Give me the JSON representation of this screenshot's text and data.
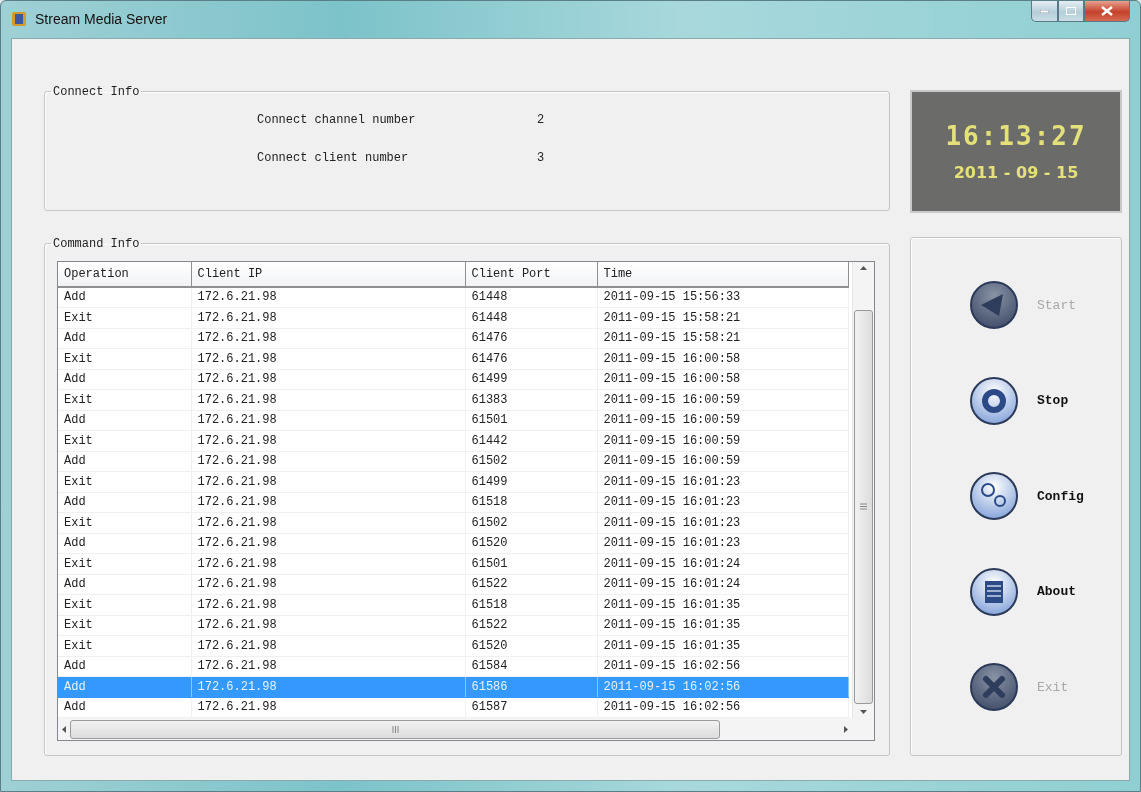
{
  "window": {
    "title": "Stream Media Server"
  },
  "connect_info": {
    "title": "Connect Info",
    "items": [
      {
        "label": "Connect channel number",
        "value": "2"
      },
      {
        "label": "Connect client number",
        "value": "3"
      }
    ]
  },
  "clock": {
    "time": "16:13:27",
    "date": "2011 - 09 - 15"
  },
  "command_info": {
    "title": "Command Info",
    "columns": [
      "Operation",
      "Client IP",
      "Client Port",
      "Time"
    ],
    "rows": [
      {
        "cells": [
          "Add",
          "172.6.21.98",
          "61448",
          "2011-09-15 15:56:33"
        ],
        "selected": false
      },
      {
        "cells": [
          "Exit",
          "172.6.21.98",
          "61448",
          "2011-09-15 15:58:21"
        ],
        "selected": false
      },
      {
        "cells": [
          "Add",
          "172.6.21.98",
          "61476",
          "2011-09-15 15:58:21"
        ],
        "selected": false
      },
      {
        "cells": [
          "Exit",
          "172.6.21.98",
          "61476",
          "2011-09-15 16:00:58"
        ],
        "selected": false
      },
      {
        "cells": [
          "Add",
          "172.6.21.98",
          "61499",
          "2011-09-15 16:00:58"
        ],
        "selected": false
      },
      {
        "cells": [
          "Exit",
          "172.6.21.98",
          "61383",
          "2011-09-15 16:00:59"
        ],
        "selected": false
      },
      {
        "cells": [
          "Add",
          "172.6.21.98",
          "61501",
          "2011-09-15 16:00:59"
        ],
        "selected": false
      },
      {
        "cells": [
          "Exit",
          "172.6.21.98",
          "61442",
          "2011-09-15 16:00:59"
        ],
        "selected": false
      },
      {
        "cells": [
          "Add",
          "172.6.21.98",
          "61502",
          "2011-09-15 16:00:59"
        ],
        "selected": false
      },
      {
        "cells": [
          "Exit",
          "172.6.21.98",
          "61499",
          "2011-09-15 16:01:23"
        ],
        "selected": false
      },
      {
        "cells": [
          "Add",
          "172.6.21.98",
          "61518",
          "2011-09-15 16:01:23"
        ],
        "selected": false
      },
      {
        "cells": [
          "Exit",
          "172.6.21.98",
          "61502",
          "2011-09-15 16:01:23"
        ],
        "selected": false
      },
      {
        "cells": [
          "Add",
          "172.6.21.98",
          "61520",
          "2011-09-15 16:01:23"
        ],
        "selected": false
      },
      {
        "cells": [
          "Exit",
          "172.6.21.98",
          "61501",
          "2011-09-15 16:01:24"
        ],
        "selected": false
      },
      {
        "cells": [
          "Add",
          "172.6.21.98",
          "61522",
          "2011-09-15 16:01:24"
        ],
        "selected": false
      },
      {
        "cells": [
          "Exit",
          "172.6.21.98",
          "61518",
          "2011-09-15 16:01:35"
        ],
        "selected": false
      },
      {
        "cells": [
          "Exit",
          "172.6.21.98",
          "61522",
          "2011-09-15 16:01:35"
        ],
        "selected": false
      },
      {
        "cells": [
          "Exit",
          "172.6.21.98",
          "61520",
          "2011-09-15 16:01:35"
        ],
        "selected": false
      },
      {
        "cells": [
          "Add",
          "172.6.21.98",
          "61584",
          "2011-09-15 16:02:56"
        ],
        "selected": false
      },
      {
        "cells": [
          "Add",
          "172.6.21.98",
          "61586",
          "2011-09-15 16:02:56"
        ],
        "selected": true
      },
      {
        "cells": [
          "Add",
          "172.6.21.98",
          "61587",
          "2011-09-15 16:02:56"
        ],
        "selected": false
      }
    ]
  },
  "buttons": [
    {
      "kind": "start",
      "label": "Start",
      "disabled": true
    },
    {
      "kind": "stop",
      "label": "Stop",
      "disabled": false
    },
    {
      "kind": "config",
      "label": "Config",
      "disabled": false
    },
    {
      "kind": "about",
      "label": "About",
      "disabled": false
    },
    {
      "kind": "exit",
      "label": "Exit",
      "disabled": true
    }
  ]
}
